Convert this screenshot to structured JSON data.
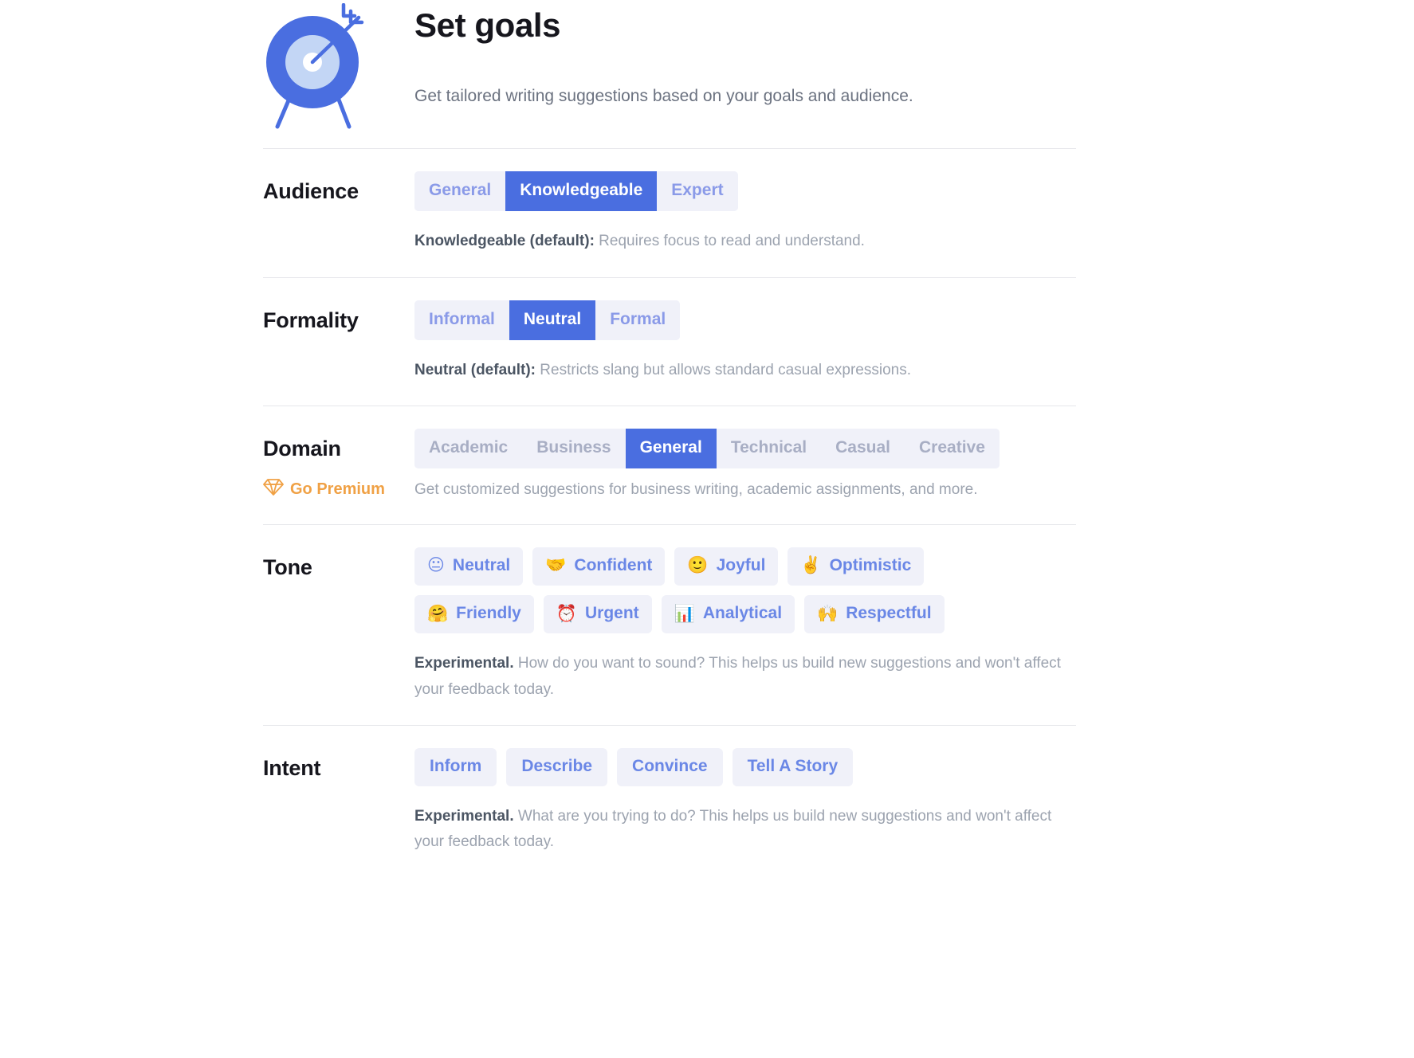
{
  "header": {
    "icon": "target-bullseye-arrow-icon",
    "title": "Set goals",
    "subtitle": "Get tailored writing suggestions based on your goals and audience."
  },
  "colors": {
    "accent_blue": "#4a6ee0",
    "chip_bg": "#f0f1f9",
    "chip_text": "#6a87e6",
    "muted_text": "#9ca3af",
    "premium_orange": "#f0a145",
    "title_dark": "#16161d"
  },
  "sections": {
    "audience": {
      "label": "Audience",
      "options": [
        "General",
        "Knowledgeable",
        "Expert"
      ],
      "selected": "Knowledgeable",
      "helper_strong": "Knowledgeable (default):",
      "helper_rest": " Requires focus to read and understand."
    },
    "formality": {
      "label": "Formality",
      "options": [
        "Informal",
        "Neutral",
        "Formal"
      ],
      "selected": "Neutral",
      "helper_strong": "Neutral (default):",
      "helper_rest": " Restricts slang but allows standard casual expressions."
    },
    "domain": {
      "label": "Domain",
      "options": [
        "Academic",
        "Business",
        "General",
        "Technical",
        "Casual",
        "Creative"
      ],
      "selected": "General",
      "premium_icon": "gem-diamond-icon",
      "premium_label": "Go Premium",
      "premium_desc": "Get customized suggestions for business writing, academic assignments, and more."
    },
    "tone": {
      "label": "Tone",
      "options": [
        {
          "emoji": "😐",
          "icon": "neutral-face-emoji",
          "label": "Neutral"
        },
        {
          "emoji": "🤝",
          "icon": "handshake-emoji",
          "label": "Confident"
        },
        {
          "emoji": "🙂",
          "icon": "slightly-smiling-face-emoji",
          "label": "Joyful"
        },
        {
          "emoji": "✌️",
          "icon": "victory-hand-emoji",
          "label": "Optimistic"
        },
        {
          "emoji": "🤗",
          "icon": "hugging-face-emoji",
          "label": "Friendly"
        },
        {
          "emoji": "⏰",
          "icon": "alarm-clock-emoji",
          "label": "Urgent"
        },
        {
          "emoji": "📊",
          "icon": "bar-chart-emoji",
          "label": "Analytical"
        },
        {
          "emoji": "🙌",
          "icon": "raising-hands-emoji",
          "label": "Respectful"
        }
      ],
      "helper_strong": "Experimental.",
      "helper_rest": " How do you want to sound? This helps us build new suggestions and won't affect your feedback today."
    },
    "intent": {
      "label": "Intent",
      "options": [
        "Inform",
        "Describe",
        "Convince",
        "Tell A Story"
      ],
      "helper_strong": "Experimental.",
      "helper_rest": " What are you trying to do? This helps us build new suggestions and won't affect your feedback today."
    }
  }
}
